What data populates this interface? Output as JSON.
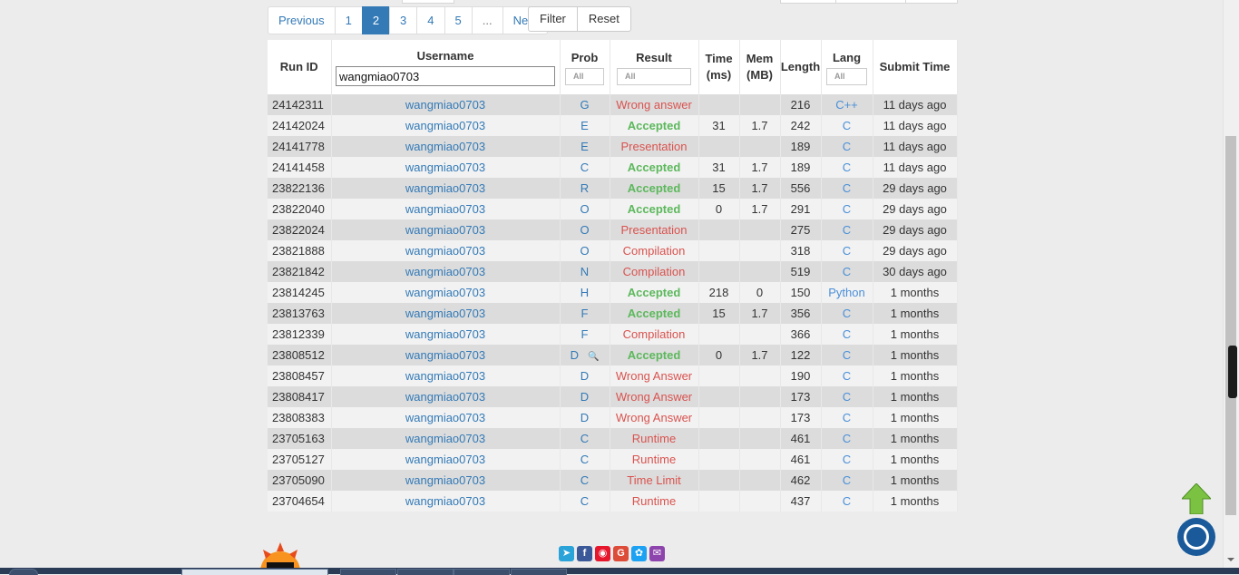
{
  "pagination": {
    "previous": "Previous",
    "pages": [
      "1",
      "2",
      "3",
      "4",
      "5"
    ],
    "active_page": "2",
    "ellipsis": "...",
    "next": "Next"
  },
  "filter_buttons": {
    "filter": "Filter",
    "reset": "Reset"
  },
  "table": {
    "headers": {
      "run_id": "Run ID",
      "username": "Username",
      "prob": "Prob",
      "result": "Result",
      "time": "Time (ms)",
      "mem": "Mem (MB)",
      "length": "Length",
      "lang": "Lang",
      "submit_time": "Submit Time"
    },
    "username_filter": "wangmiao0703",
    "prob_filter": "All",
    "result_filter": "All",
    "lang_filter": "All",
    "rows": [
      {
        "run_id": "24142311",
        "user": "wangmiao0703",
        "prob": "G",
        "result": "Wrong answer",
        "status": "error",
        "time": "",
        "mem": "",
        "length": "216",
        "lang": "C++",
        "submit": "11 days ago"
      },
      {
        "run_id": "24142024",
        "user": "wangmiao0703",
        "prob": "E",
        "result": "Accepted",
        "status": "accepted",
        "time": "31",
        "mem": "1.7",
        "length": "242",
        "lang": "C",
        "submit": "11 days ago"
      },
      {
        "run_id": "24141778",
        "user": "wangmiao0703",
        "prob": "E",
        "result": "Presentation",
        "status": "error",
        "time": "",
        "mem": "",
        "length": "189",
        "lang": "C",
        "submit": "11 days ago"
      },
      {
        "run_id": "24141458",
        "user": "wangmiao0703",
        "prob": "C",
        "result": "Accepted",
        "status": "accepted",
        "time": "31",
        "mem": "1.7",
        "length": "189",
        "lang": "C",
        "submit": "11 days ago"
      },
      {
        "run_id": "23822136",
        "user": "wangmiao0703",
        "prob": "R",
        "result": "Accepted",
        "status": "accepted",
        "time": "15",
        "mem": "1.7",
        "length": "556",
        "lang": "C",
        "submit": "29 days ago"
      },
      {
        "run_id": "23822040",
        "user": "wangmiao0703",
        "prob": "O",
        "result": "Accepted",
        "status": "accepted",
        "time": "0",
        "mem": "1.7",
        "length": "291",
        "lang": "C",
        "submit": "29 days ago"
      },
      {
        "run_id": "23822024",
        "user": "wangmiao0703",
        "prob": "O",
        "result": "Presentation",
        "status": "error",
        "time": "",
        "mem": "",
        "length": "275",
        "lang": "C",
        "submit": "29 days ago"
      },
      {
        "run_id": "23821888",
        "user": "wangmiao0703",
        "prob": "O",
        "result": "Compilation",
        "status": "error",
        "time": "",
        "mem": "",
        "length": "318",
        "lang": "C",
        "submit": "29 days ago"
      },
      {
        "run_id": "23821842",
        "user": "wangmiao0703",
        "prob": "N",
        "result": "Compilation",
        "status": "error",
        "time": "",
        "mem": "",
        "length": "519",
        "lang": "C",
        "submit": "30 days ago"
      },
      {
        "run_id": "23814245",
        "user": "wangmiao0703",
        "prob": "H",
        "result": "Accepted",
        "status": "accepted",
        "time": "218",
        "mem": "0",
        "length": "150",
        "lang": "Python",
        "submit": "1 months"
      },
      {
        "run_id": "23813763",
        "user": "wangmiao0703",
        "prob": "F",
        "result": "Accepted",
        "status": "accepted",
        "time": "15",
        "mem": "1.7",
        "length": "356",
        "lang": "C",
        "submit": "1 months"
      },
      {
        "run_id": "23812339",
        "user": "wangmiao0703",
        "prob": "F",
        "result": "Compilation",
        "status": "error",
        "time": "",
        "mem": "",
        "length": "366",
        "lang": "C",
        "submit": "1 months"
      },
      {
        "run_id": "23808512",
        "user": "wangmiao0703",
        "prob": "D",
        "result": "Accepted",
        "status": "accepted",
        "time": "0",
        "mem": "1.7",
        "length": "122",
        "lang": "C",
        "submit": "1 months",
        "magnifier": true
      },
      {
        "run_id": "23808457",
        "user": "wangmiao0703",
        "prob": "D",
        "result": "Wrong Answer",
        "status": "error",
        "time": "",
        "mem": "",
        "length": "190",
        "lang": "C",
        "submit": "1 months"
      },
      {
        "run_id": "23808417",
        "user": "wangmiao0703",
        "prob": "D",
        "result": "Wrong Answer",
        "status": "error",
        "time": "",
        "mem": "",
        "length": "173",
        "lang": "C",
        "submit": "1 months"
      },
      {
        "run_id": "23808383",
        "user": "wangmiao0703",
        "prob": "D",
        "result": "Wrong Answer",
        "status": "error",
        "time": "",
        "mem": "",
        "length": "173",
        "lang": "C",
        "submit": "1 months"
      },
      {
        "run_id": "23705163",
        "user": "wangmiao0703",
        "prob": "C",
        "result": "Runtime",
        "status": "error",
        "time": "",
        "mem": "",
        "length": "461",
        "lang": "C",
        "submit": "1 months"
      },
      {
        "run_id": "23705127",
        "user": "wangmiao0703",
        "prob": "C",
        "result": "Runtime",
        "status": "error",
        "time": "",
        "mem": "",
        "length": "461",
        "lang": "C",
        "submit": "1 months"
      },
      {
        "run_id": "23705090",
        "user": "wangmiao0703",
        "prob": "C",
        "result": "Time Limit",
        "status": "error",
        "time": "",
        "mem": "",
        "length": "462",
        "lang": "C",
        "submit": "1 months"
      },
      {
        "run_id": "23704654",
        "user": "wangmiao0703",
        "prob": "C",
        "result": "Runtime",
        "status": "error",
        "time": "",
        "mem": "",
        "length": "437",
        "lang": "C",
        "submit": "1 months"
      }
    ]
  },
  "colors": {
    "accepted": "#5cb85c",
    "error": "#d9534f",
    "link": "#337ab7"
  },
  "share_icons": [
    "telegram-icon",
    "facebook-icon",
    "weibo-icon",
    "google-icon",
    "twitter-icon",
    "email-icon"
  ]
}
